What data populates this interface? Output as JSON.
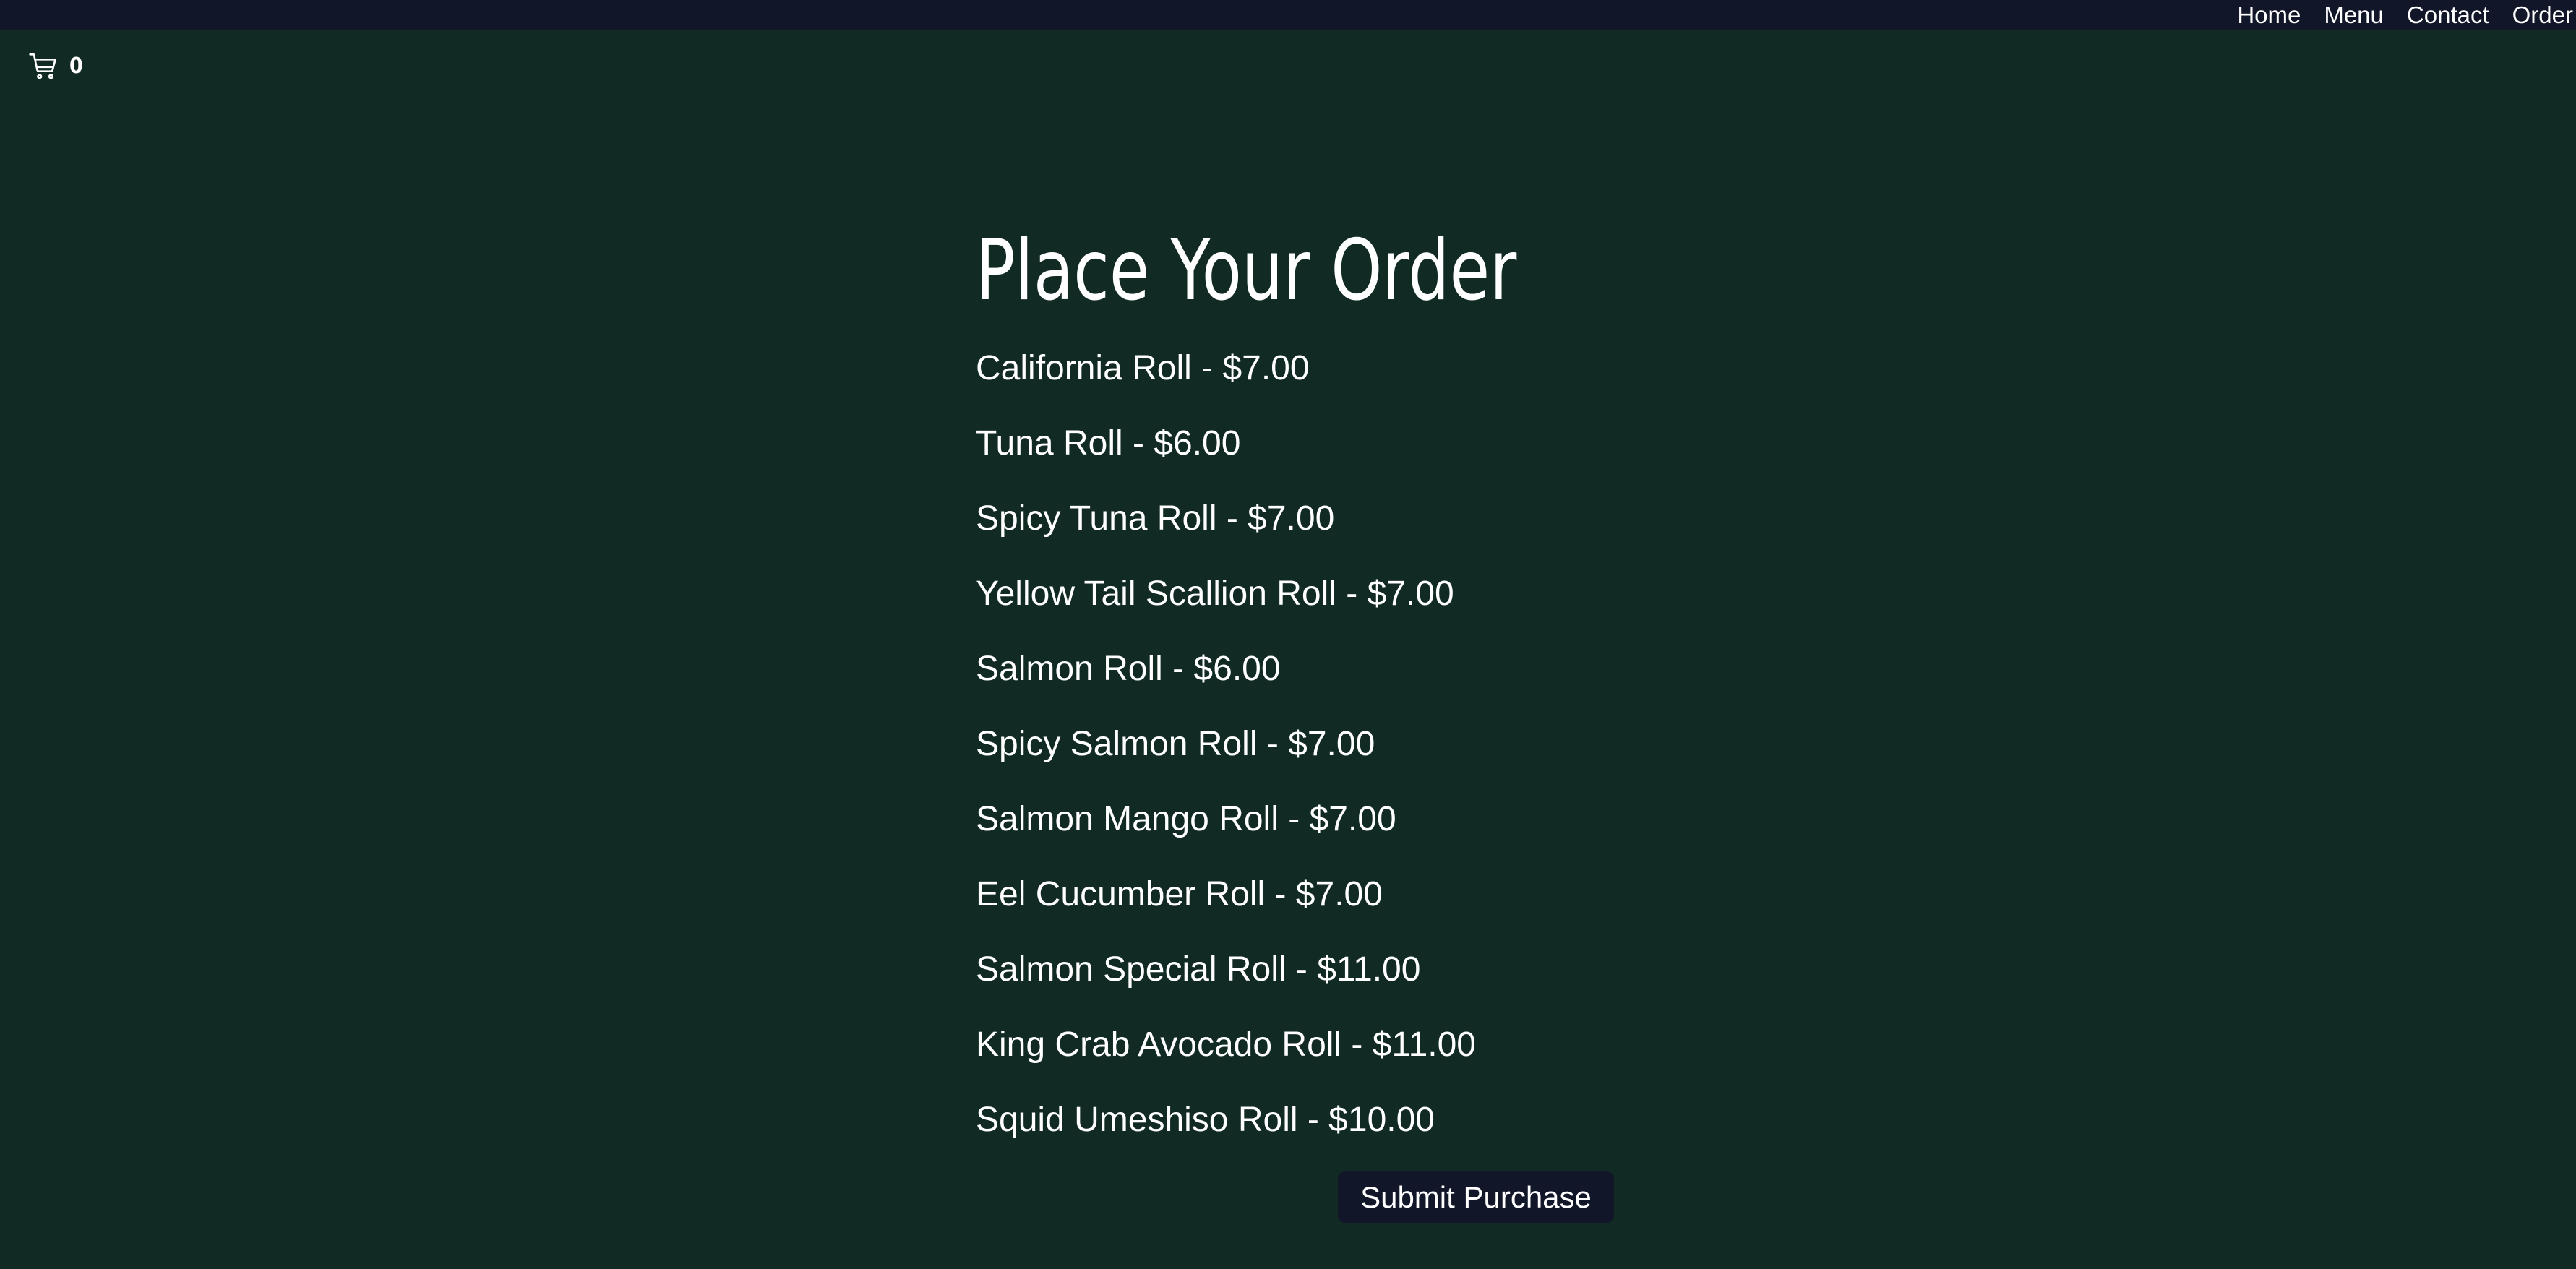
{
  "nav": {
    "items": [
      {
        "label": "Home"
      },
      {
        "label": "Menu"
      },
      {
        "label": "Contact"
      },
      {
        "label": "Order"
      }
    ]
  },
  "cart": {
    "icon": "cart-icon",
    "count": "0"
  },
  "order": {
    "title": "Place Your Order",
    "items": [
      {
        "label": "California Roll - $7.00"
      },
      {
        "label": "Tuna Roll - $6.00"
      },
      {
        "label": "Spicy Tuna Roll - $7.00"
      },
      {
        "label": "Yellow Tail Scallion Roll - $7.00"
      },
      {
        "label": "Salmon Roll - $6.00"
      },
      {
        "label": "Spicy Salmon Roll - $7.00"
      },
      {
        "label": "Salmon Mango Roll - $7.00"
      },
      {
        "label": "Eel Cucumber Roll - $7.00"
      },
      {
        "label": "Salmon Special Roll - $11.00"
      },
      {
        "label": "King Crab Avocado Roll - $11.00"
      },
      {
        "label": "Squid Umeshiso Roll - $10.00"
      }
    ],
    "submit_label": "Submit Purchase"
  },
  "colors": {
    "background": "#112a24",
    "header": "#111629",
    "button": "#111629",
    "text": "#ffffff"
  }
}
